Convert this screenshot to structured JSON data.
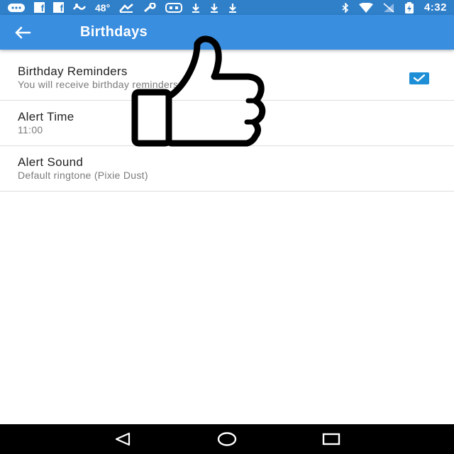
{
  "statusbar": {
    "temperature": "48°",
    "time": "4:32",
    "fb_letter": "f"
  },
  "appbar": {
    "title": "Birthdays",
    "back_icon": "arrow-back-icon"
  },
  "settings": [
    {
      "title": "Birthday Reminders",
      "subtitle": "You will receive birthday reminders",
      "checked": true
    },
    {
      "title": "Alert Time",
      "subtitle": "11:00"
    },
    {
      "title": "Alert Sound",
      "subtitle": "Default ringtone (Pixie Dust)"
    }
  ],
  "colors": {
    "statusbar": "#2f7fc9",
    "appbar": "#3a8ee0",
    "checkbox": "#1e8fd6"
  },
  "overlay_icon": "thumbs-up-icon"
}
